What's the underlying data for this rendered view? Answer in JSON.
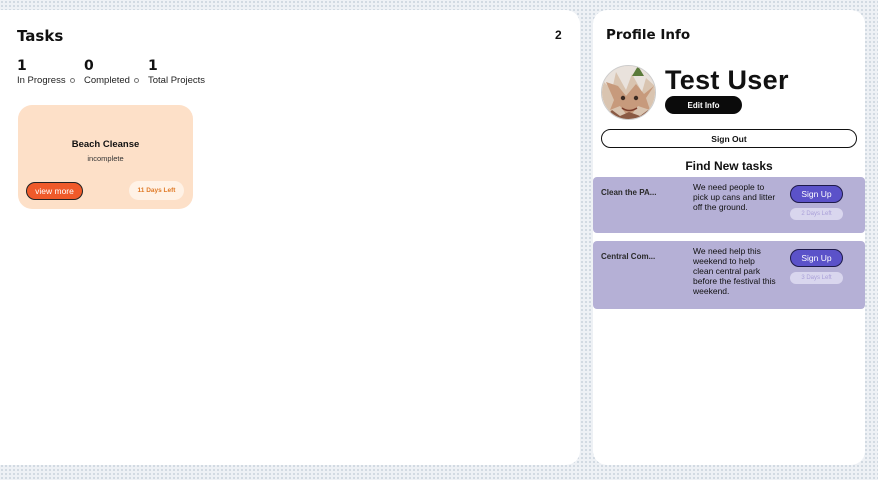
{
  "tasks": {
    "title": "Tasks",
    "count": "2",
    "stats": [
      {
        "value": "1",
        "label": "In Progress"
      },
      {
        "value": "0",
        "label": "Completed"
      },
      {
        "value": "1",
        "label": "Total Projects"
      }
    ],
    "cards": [
      {
        "title": "Beach Cleanse",
        "status": "incomplete",
        "view_label": "view more",
        "days_left": "11 Days Left"
      }
    ]
  },
  "profile": {
    "title": "Profile Info",
    "user_name": "Test User",
    "edit_label": "Edit Info",
    "sign_out_label": "Sign Out",
    "find_title": "Find New tasks"
  },
  "jobs": [
    {
      "name": "Clean the PA...",
      "description": "We need people to pick up cans and litter off the ground.",
      "signup_label": "Sign Up",
      "days_left": "2 Days Left"
    },
    {
      "name": "Central Com...",
      "description": "We need help this weekend to help clean central park before the festival this weekend.",
      "signup_label": "Sign Up",
      "days_left": "3 Days Left"
    }
  ],
  "colors": {
    "task_card_bg": "#fde0c8",
    "view_more_bg": "#ef5a2a",
    "job_card_bg": "#b5b0d6",
    "signup_bg": "#5b52c9"
  }
}
